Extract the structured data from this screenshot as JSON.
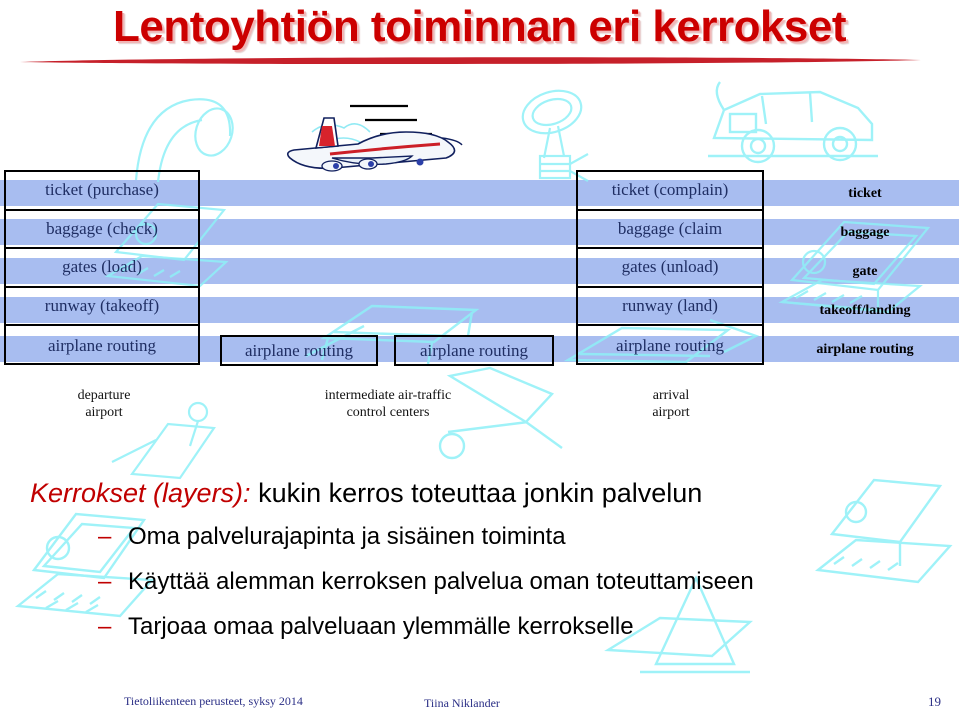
{
  "slide": {
    "title": "Lentoyhtiön toiminnan eri kerrokset",
    "accent_red": "#CC0000",
    "band_blue": "#A8BDF0",
    "box_text_blue": "#1F2E63",
    "watermark_cyan": "#8FF0F7"
  },
  "diagram": {
    "departure_column": {
      "cells": [
        "ticket (purchase)",
        "baggage (check)",
        "gates (load)",
        "runway (takeoff)",
        "airplane routing"
      ]
    },
    "intermediate_boxes": [
      "airplane routing",
      "airplane routing"
    ],
    "arrival_column": {
      "cells": [
        "ticket (complain)",
        "baggage (claim",
        "gates (unload)",
        "runway (land)",
        "airplane routing"
      ]
    },
    "layer_names": [
      "ticket",
      "baggage",
      "gate",
      "takeoff/landing",
      "airplane routing"
    ],
    "captions": {
      "departure_line1": "departure",
      "departure_line2": "airport",
      "intermediate_line1": "intermediate air-traffic",
      "intermediate_line2": "control centers",
      "arrival_line1": "arrival",
      "arrival_line2": "airport"
    }
  },
  "body": {
    "lead_emphasis": "Kerrokset (layers):",
    "lead_rest": " kukin kerros toteuttaa jonkin palvelun",
    "bullet_marker": "–",
    "bullets": [
      "Oma palvelurajapinta ja sisäinen toiminta",
      "Käyttää alemman kerroksen palvelua oman toteuttamiseen",
      "Tarjoaa omaa palveluaan ylemmälle kerrokselle"
    ]
  },
  "footer": {
    "course": "Tietoliikenteen perusteet, syksy 2014",
    "author": "Tiina Niklander",
    "page": "19"
  }
}
